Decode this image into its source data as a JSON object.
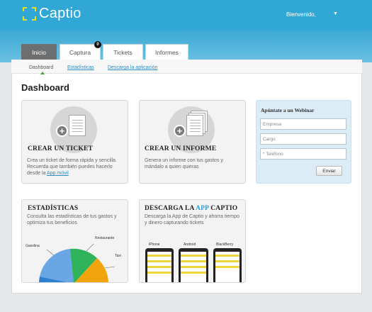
{
  "header": {
    "logo_text_main": "Capt",
    "logo_text_end": "io",
    "welcome": "Bienvenido,",
    "caret": "▼"
  },
  "tabs": [
    {
      "label": "Inicio",
      "active": true
    },
    {
      "label": "Captura",
      "active": false,
      "badge": "0"
    },
    {
      "label": "Tickets",
      "active": false
    },
    {
      "label": "Informes",
      "active": false
    }
  ],
  "subnav": {
    "dashboard": "Dashboard",
    "estadisticas": "Estadísticas",
    "descarga": "Descarga la aplicación"
  },
  "page_title": "Dashboard",
  "cards": {
    "ticket": {
      "title": "CREAR UN TICKET",
      "desc_1": "Crea un ticket de forma rápida y sencilla.",
      "desc_2": "Recuerda que también puedes hacerlo",
      "desc_3": "desde la ",
      "link": "App móvil"
    },
    "informe": {
      "title": "CREAR UN INFORME",
      "desc_1": "Genera un informe con tus gastos y",
      "desc_2": "mándalo a quien quieras"
    },
    "estadisticas": {
      "title": "ESTADÍSTICAS",
      "desc_1": "Consulta las estadísticas de tus gastos y",
      "desc_2": "optimiza tus beneficios",
      "pie_labels": [
        "Gasolina",
        "Restaurante",
        "Taxi"
      ],
      "pie_colors": [
        "#6aa6e6",
        "#2fb35a",
        "#f1a40b",
        "#2f7fd1"
      ]
    },
    "app": {
      "title_1": "DESCARGA LA ",
      "title_app": "APP",
      "title_2": " CAPTIO",
      "desc_1": "Descarga la App de Captio y ahorra tiempo",
      "desc_2": "y dinero capturando tickets",
      "platforms": [
        "iPhone",
        "Android",
        "BlackBerry"
      ]
    }
  },
  "webinar": {
    "title": "Apúntate a un Webinar",
    "empresa_placeholder": "Empresa",
    "cargo_placeholder": "Cargo",
    "telefono_placeholder": "* Teléfono",
    "send_label": "Enviar"
  },
  "colors": {
    "header": "#31a7d6",
    "logo_accent": "#e8e21c",
    "link": "#2a8fc7",
    "active_tab": "#6d6e70"
  }
}
